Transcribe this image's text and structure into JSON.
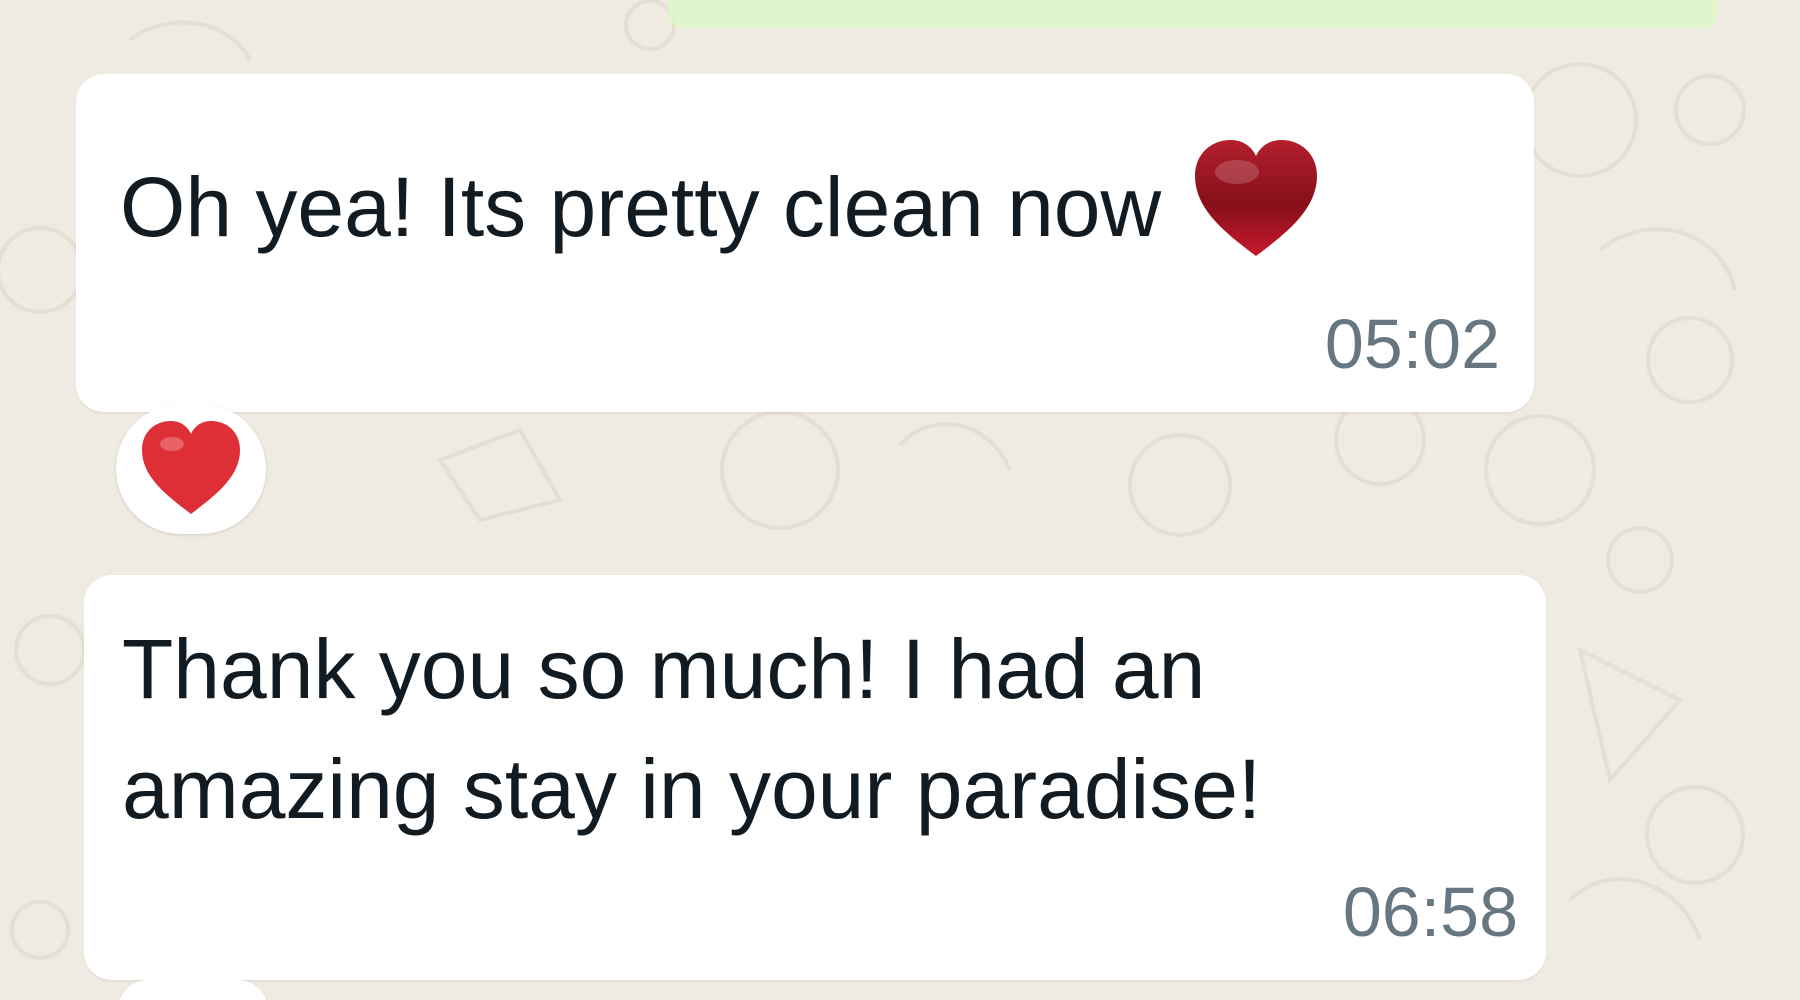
{
  "colors": {
    "chat_background": "#efeae2",
    "incoming_bubble": "#ffffff",
    "outgoing_bubble": "#dcf8c6",
    "message_text": "#111b21",
    "timestamp_text": "#667781",
    "heart_red": "#d7262f"
  },
  "messages": [
    {
      "text": "Oh yea! Its pretty clean now",
      "time": "05:02",
      "inline_emoji": "red-heart-icon",
      "reaction": "red-heart-icon"
    },
    {
      "text": "Thank you so much! I had an amazing stay in your paradise!",
      "time": "06:58"
    }
  ]
}
